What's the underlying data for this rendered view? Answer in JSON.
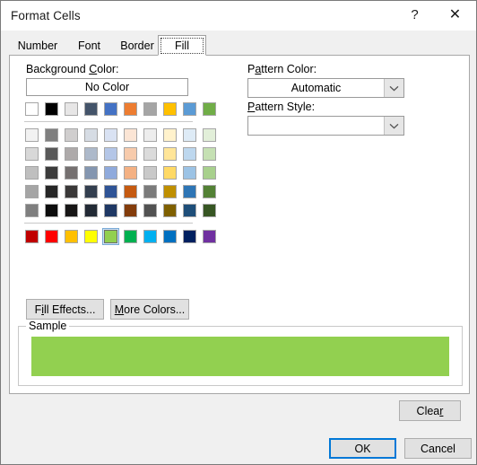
{
  "window": {
    "title": "Format Cells",
    "help_icon": "?",
    "close_icon": "✕"
  },
  "tabs": [
    {
      "label": "Number",
      "selected": false
    },
    {
      "label": "Font",
      "selected": false
    },
    {
      "label": "Border",
      "selected": false
    },
    {
      "label": "Fill",
      "selected": true
    }
  ],
  "background_color": {
    "label_prefix": "Background ",
    "label_accel": "C",
    "label_suffix": "olor:",
    "no_color_label": "No Color",
    "theme_colors": [
      "#ffffff",
      "#000000",
      "#e7e6e6",
      "#44546a",
      "#4472c4",
      "#ed7d31",
      "#a5a5a5",
      "#ffc000",
      "#5b9bd5",
      "#70ad47"
    ],
    "tint_rows": [
      [
        "#f2f2f2",
        "#7f7f7f",
        "#d0cece",
        "#d6dce4",
        "#d9e2f3",
        "#fbe5d5",
        "#ededed",
        "#fff2cc",
        "#deebf6",
        "#e2efd9"
      ],
      [
        "#d8d8d8",
        "#595959",
        "#aeaaaa",
        "#adb9ca",
        "#b4c6e7",
        "#f7cbac",
        "#dbdbdb",
        "#ffe598",
        "#bdd7ee",
        "#c5e0b3"
      ],
      [
        "#bfbfbf",
        "#3b3b3b",
        "#757070",
        "#8496b0",
        "#8faadc",
        "#f4b183",
        "#c9c9c9",
        "#ffd965",
        "#9cc3e5",
        "#a8d08d"
      ],
      [
        "#a5a5a5",
        "#262626",
        "#3a3838",
        "#333f4f",
        "#2f5496",
        "#c55a11",
        "#7b7b7b",
        "#bf8f00",
        "#2e75b5",
        "#538135"
      ],
      [
        "#7f7f7f",
        "#0c0c0c",
        "#171616",
        "#222a35",
        "#1f3864",
        "#833c0b",
        "#525252",
        "#7f6000",
        "#1e4e79",
        "#375623"
      ]
    ],
    "standard_colors": [
      "#c00000",
      "#ff0000",
      "#ffc000",
      "#ffff00",
      "#92d050",
      "#00b050",
      "#00b0f0",
      "#0070c0",
      "#002060",
      "#7030a0"
    ],
    "selected_standard_index": 4,
    "fill_effects": {
      "prefix": "F",
      "accel": "i",
      "suffix": "ll Effects..."
    },
    "more_colors": {
      "accel": "M",
      "suffix": "ore Colors..."
    }
  },
  "pattern_color": {
    "label_accel": "P",
    "label_mid": "a",
    "label_suffix": "ttern Color:",
    "value": "Automatic"
  },
  "pattern_style": {
    "label_accel": "P",
    "label_suffix": "attern Style:",
    "value": ""
  },
  "sample": {
    "legend": "Sample",
    "fill_color": "#92d050"
  },
  "buttons": {
    "clear": {
      "prefix": "Clea",
      "accel": "r",
      "suffix": ""
    },
    "ok": "OK",
    "cancel": "Cancel"
  },
  "colors": {
    "accent": "#0078d7",
    "dialog_bg": "#f0f0f0",
    "panel_bg": "#ffffff",
    "border": "#a7a7a7"
  }
}
